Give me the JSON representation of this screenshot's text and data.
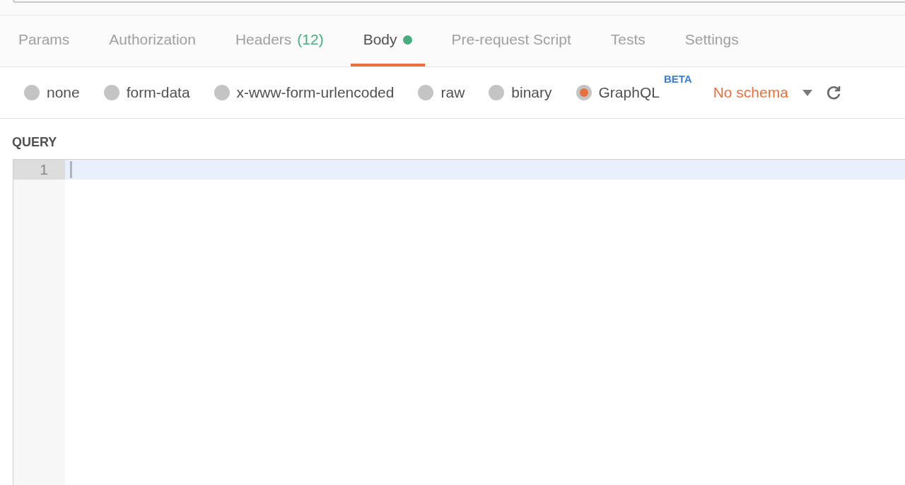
{
  "tabs": [
    {
      "label": "Params",
      "selected": false
    },
    {
      "label": "Authorization",
      "selected": false
    },
    {
      "label": "Headers",
      "count": "(12)",
      "selected": false
    },
    {
      "label": "Body",
      "has_content": true,
      "selected": true
    },
    {
      "label": "Pre-request Script",
      "selected": false
    },
    {
      "label": "Tests",
      "selected": false
    },
    {
      "label": "Settings",
      "selected": false
    }
  ],
  "body_types": [
    {
      "label": "none",
      "selected": false
    },
    {
      "label": "form-data",
      "selected": false
    },
    {
      "label": "x-www-form-urlencoded",
      "selected": false
    },
    {
      "label": "raw",
      "selected": false
    },
    {
      "label": "binary",
      "selected": false
    },
    {
      "label": "GraphQL",
      "badge": "BETA",
      "selected": true
    }
  ],
  "schema_select": {
    "value": "No schema"
  },
  "query": {
    "label": "QUERY",
    "line_numbers": [
      "1"
    ]
  }
}
